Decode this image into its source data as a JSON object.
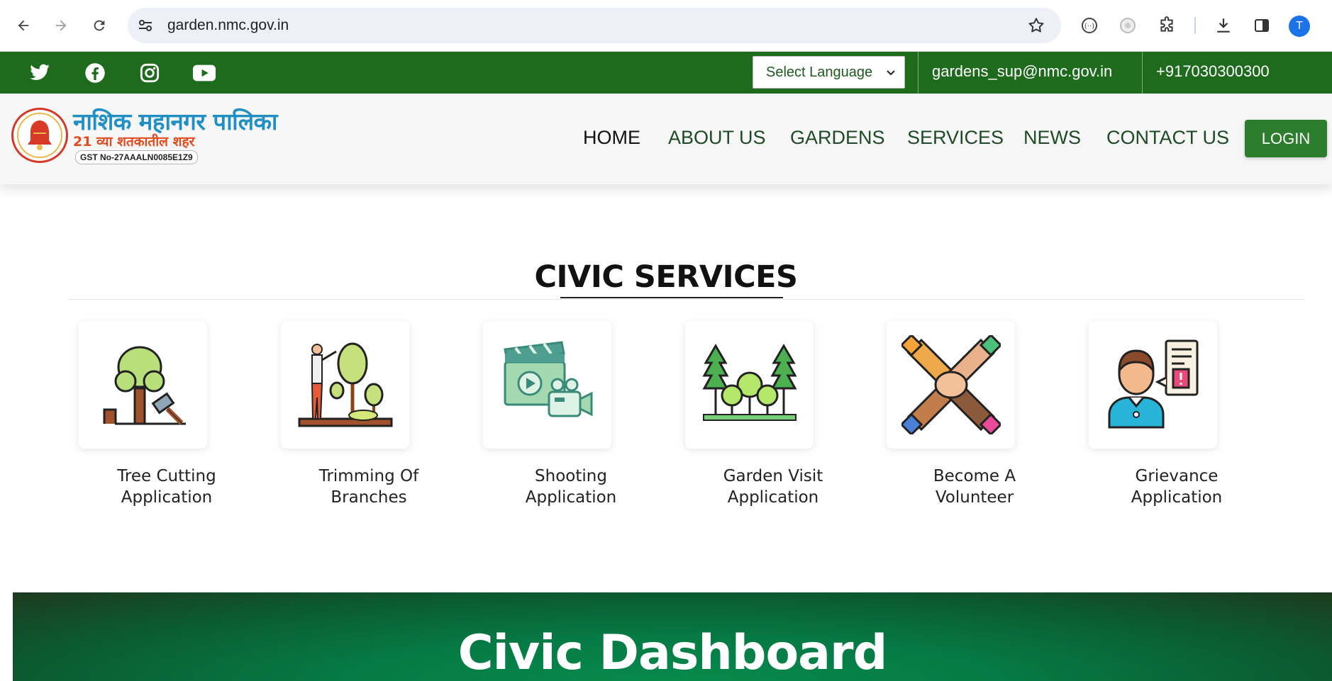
{
  "browser": {
    "url": "garden.nmc.gov.in",
    "profile_initial": "T"
  },
  "topbar": {
    "social": [
      "twitter-icon",
      "facebook-icon",
      "instagram-icon",
      "youtube-icon"
    ],
    "language_select": "Select Language",
    "email": "gardens_sup@nmc.gov.in",
    "phone": "+917030300300"
  },
  "header": {
    "logo_title": "नाशिक महानगर पालिका",
    "logo_subtitle": "21 व्या शतकातील शहर",
    "gst": "GST No-27AAALN0085E1Z9",
    "menu": [
      "HOME",
      "ABOUT US",
      "GARDENS",
      "SERVICES",
      "NEWS",
      "CONTACT US"
    ],
    "login": "LOGIN"
  },
  "civic_services": {
    "title": "CIVIC SERVICES",
    "items": [
      {
        "label_line1": "Tree Cutting",
        "label_line2": "Application",
        "icon": "tree-cutting-icon"
      },
      {
        "label_line1": "Trimming Of",
        "label_line2": "Branches",
        "icon": "tree-trimming-icon"
      },
      {
        "label_line1": "Shooting",
        "label_line2": "Application",
        "icon": "film-shooting-icon"
      },
      {
        "label_line1": "Garden Visit",
        "label_line2": "Application",
        "icon": "garden-visit-icon"
      },
      {
        "label_line1": "Become A",
        "label_line2": "Volunteer",
        "icon": "volunteer-hands-icon"
      },
      {
        "label_line1": "Grievance",
        "label_line2": "Application",
        "icon": "grievance-icon"
      }
    ]
  },
  "dashboard": {
    "title": "Civic Dashboard"
  },
  "colors": {
    "brand_green": "#1e6b1e",
    "button_green": "#2c7e2e",
    "menu_text": "#1e4a25"
  }
}
